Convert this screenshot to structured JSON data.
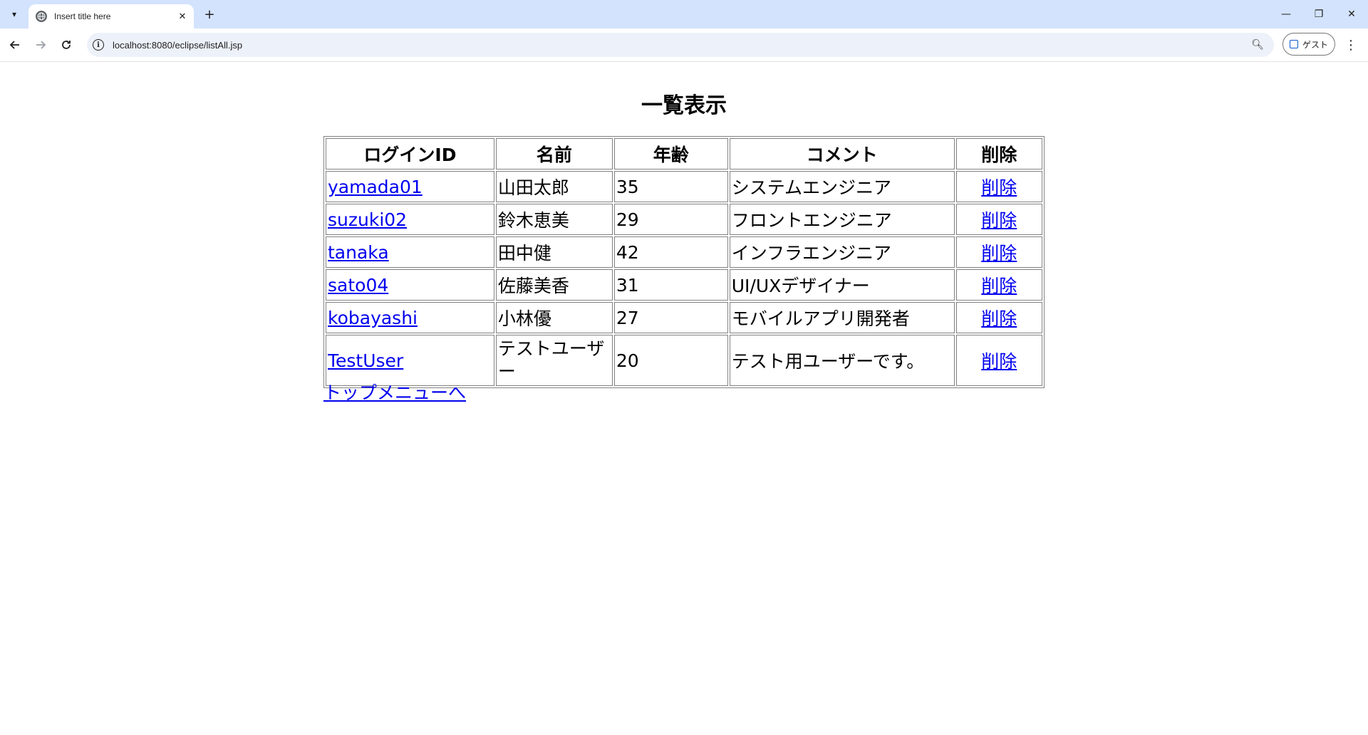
{
  "browser": {
    "tab_title": "Insert title here",
    "url": "localhost:8080/eclipse/listAll.jsp",
    "profile_label": "ゲスト"
  },
  "page": {
    "title": "一覧表示",
    "columns": [
      "ログインID",
      "名前",
      "年齢",
      "コメント",
      "削除"
    ],
    "rows": [
      {
        "login_id": "yamada01",
        "name": "山田太郎",
        "age": "35",
        "comment": "システムエンジニア",
        "delete": "削除"
      },
      {
        "login_id": "suzuki02",
        "name": "鈴木恵美",
        "age": "29",
        "comment": "フロントエンジニア",
        "delete": "削除"
      },
      {
        "login_id": "tanaka",
        "name": "田中健",
        "age": "42",
        "comment": "インフラエンジニア",
        "delete": "削除"
      },
      {
        "login_id": "sato04",
        "name": "佐藤美香",
        "age": "31",
        "comment": "UI/UXデザイナー",
        "delete": "削除"
      },
      {
        "login_id": "kobayashi",
        "name": "小林優",
        "age": "27",
        "comment": "モバイルアプリ開発者",
        "delete": "削除"
      },
      {
        "login_id": "TestUser",
        "name": "テストユーザー",
        "age": "20",
        "comment": "テスト用ユーザーです。",
        "delete": "削除"
      }
    ],
    "back_link": "トップメニューへ"
  },
  "colors": {
    "tabstrip": "#d3e3fd",
    "link": "#0000ee",
    "border": "#808080"
  }
}
